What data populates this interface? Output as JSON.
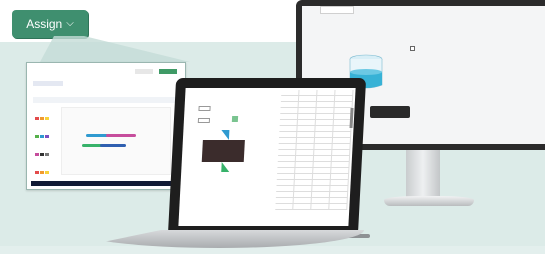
{
  "assign_menu": {
    "label": "Assign",
    "chevron": "chevron-down-icon"
  },
  "colors": {
    "accent_green": "#3f8f6f",
    "background_teal": "#dcebe8",
    "beaker_blue": "#37b2d6"
  },
  "monitor": {
    "panel_title": "",
    "checkbox_label": "",
    "info_lines": []
  },
  "laptop": {
    "grid_headers": [],
    "grid_rows": 20
  }
}
